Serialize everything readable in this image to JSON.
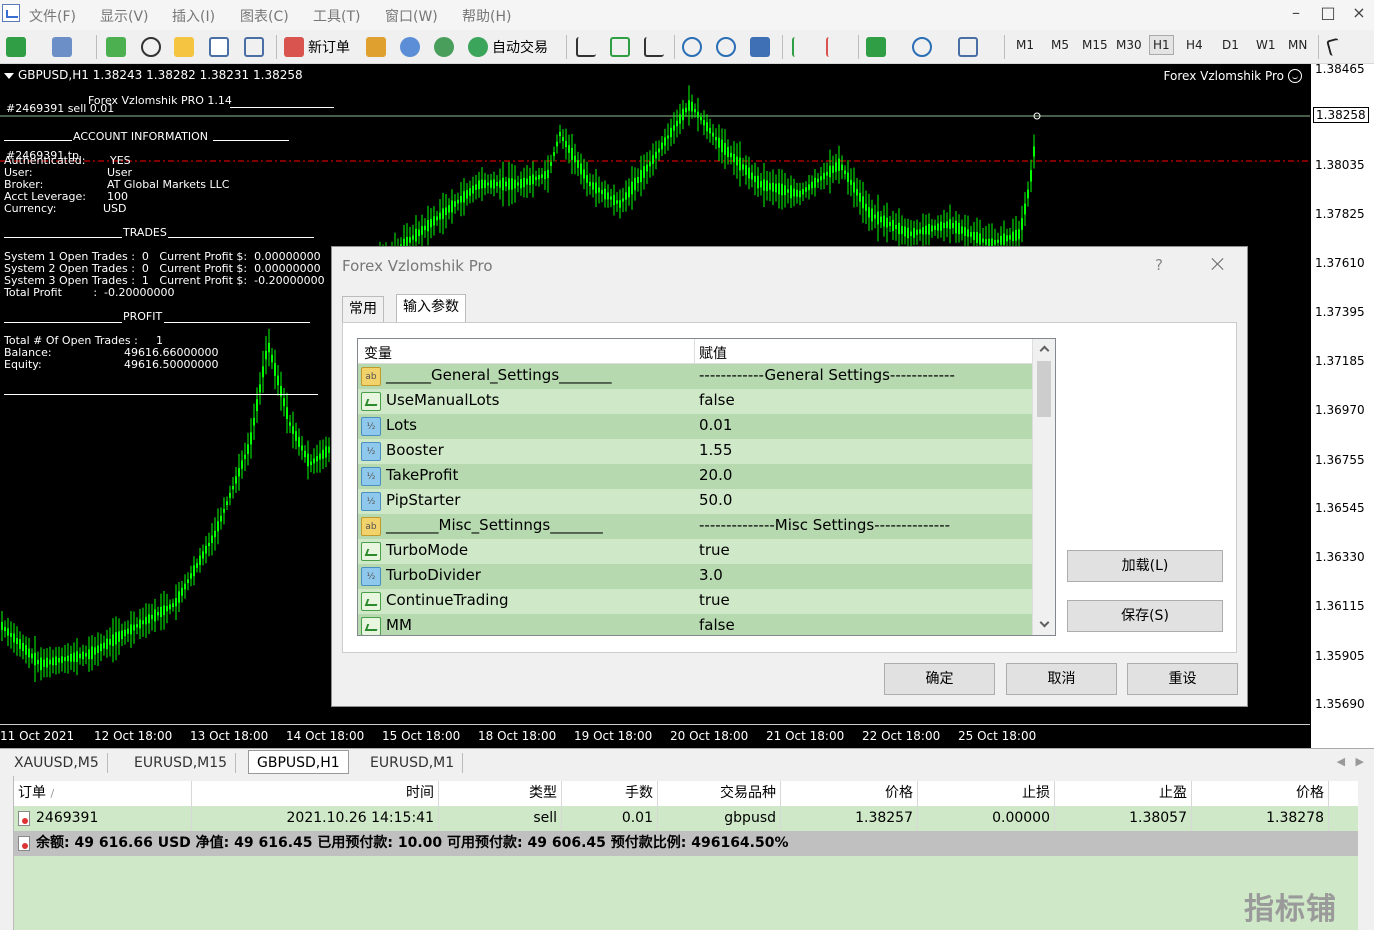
{
  "menubar": {
    "items": [
      "文件(F)",
      "显示(V)",
      "插入(I)",
      "图表(C)",
      "工具(T)",
      "窗口(W)",
      "帮助(H)"
    ],
    "window_buttons": [
      "–",
      "□",
      "×"
    ]
  },
  "toolbar": {
    "new_order_label": "新订单",
    "auto_trading_label": "自动交易",
    "timeframes": [
      "M1",
      "M5",
      "M15",
      "M30",
      "H1",
      "H4",
      "D1",
      "W1",
      "MN"
    ],
    "active_timeframe": "H1"
  },
  "chart": {
    "title": "GBPUSD,H1  1.38243 1.38282 1.38231 1.38258",
    "ea_name": "Forex Vzlomshik Pro",
    "order_label": "#2469391 sell 0.01",
    "tp_label": "#2469391 tp",
    "header_line": "Forex Vzlomshik PRO 1.14",
    "account_header": "ACCOUNT INFORMATION",
    "account": [
      {
        "k": "Authenticated:",
        "v": "YES"
      },
      {
        "k": "User:",
        "v": "User"
      },
      {
        "k": "Broker:",
        "v": "AT Global Markets LLC"
      },
      {
        "k": "Acct Leverage:",
        "v": "100"
      },
      {
        "k": "Currency:",
        "v": "USD"
      }
    ],
    "trades_header": "TRADES",
    "trades": [
      "System 1 Open Trades :  0   Current Profit $:  0.00000000",
      "System 2 Open Trades :  0   Current Profit $:  0.00000000",
      "System 3 Open Trades :  1   Current Profit $:  -0.20000000",
      "Total Profit         :  -0.20000000"
    ],
    "profit_header": "PROFIT",
    "profit": [
      {
        "k": "Total # Of Open Trades :",
        "v": "1"
      },
      {
        "k": "Balance:",
        "v": "49616.66000000"
      },
      {
        "k": "Equity:",
        "v": "49616.50000000"
      }
    ],
    "price_labels": [
      "1.38465",
      "1.38035",
      "1.37825",
      "1.37610",
      "1.37395",
      "1.37185",
      "1.36970",
      "1.36755",
      "1.36545",
      "1.36330",
      "1.36115",
      "1.35905",
      "1.35690"
    ],
    "current_price": "1.38258",
    "time_labels": [
      "11 Oct 2021",
      "12 Oct 18:00",
      "13 Oct 18:00",
      "14 Oct 18:00",
      "15 Oct 18:00",
      "18 Oct 18:00",
      "19 Oct 18:00",
      "20 Oct 18:00",
      "21 Oct 18:00",
      "22 Oct 18:00",
      "25 Oct 18:00"
    ],
    "colors": {
      "bg": "#000000",
      "candle": "#00ff00",
      "bid_line": "#8fbc8f",
      "tp_line": "#ff0000"
    }
  },
  "chart_tabs": {
    "items": [
      "XAUUSD,M5",
      "EURUSD,M15",
      "GBPUSD,H1",
      "EURUSD,M1"
    ],
    "active": "GBPUSD,H1"
  },
  "terminal": {
    "headers": [
      "订单",
      "/",
      "时间",
      "类型",
      "手数",
      "交易品种",
      "价格",
      "止损",
      "止盈",
      "价格"
    ],
    "order": {
      "id": "2469391",
      "time": "2021.10.26 14:15:41",
      "type": "sell",
      "lots": "0.01",
      "symbol": "gbpusd",
      "price": "1.38257",
      "sl": "0.00000",
      "tp": "1.38057",
      "cur_price": "1.38278"
    },
    "balance_line": "余额: 49 616.66 USD  净值: 49 616.45  已用预付款: 10.00  可用预付款: 49 606.45  预付款比例: 496164.50%"
  },
  "dialog": {
    "title": "Forex Vzlomshik Pro",
    "help": "?",
    "tabs": [
      "常用",
      "输入参数"
    ],
    "active_tab": "输入参数",
    "columns": [
      "变量",
      "赋值"
    ],
    "params": [
      {
        "icon": "ab",
        "name": "______General_Settings_______",
        "value": "------------General Settings------------"
      },
      {
        "icon": "bool",
        "name": "UseManualLots",
        "value": "false"
      },
      {
        "icon": "v2",
        "name": "Lots",
        "value": "0.01"
      },
      {
        "icon": "v2",
        "name": "Booster",
        "value": "1.55"
      },
      {
        "icon": "v2",
        "name": "TakeProfit",
        "value": "20.0"
      },
      {
        "icon": "v2",
        "name": "PipStarter",
        "value": "50.0"
      },
      {
        "icon": "ab",
        "name": "_______Misc_Settinngs_______",
        "value": "--------------Misc Settings--------------"
      },
      {
        "icon": "bool",
        "name": "TurboMode",
        "value": "true"
      },
      {
        "icon": "v2",
        "name": "TurboDivider",
        "value": "3.0"
      },
      {
        "icon": "bool",
        "name": "ContinueTrading",
        "value": "true"
      },
      {
        "icon": "bool",
        "name": "MM",
        "value": "false"
      }
    ],
    "load_button": "加载(L)",
    "save_button": "保存(S)",
    "ok_button": "确定",
    "cancel_button": "取消",
    "reset_button": "重设"
  },
  "watermark": "指标铺"
}
